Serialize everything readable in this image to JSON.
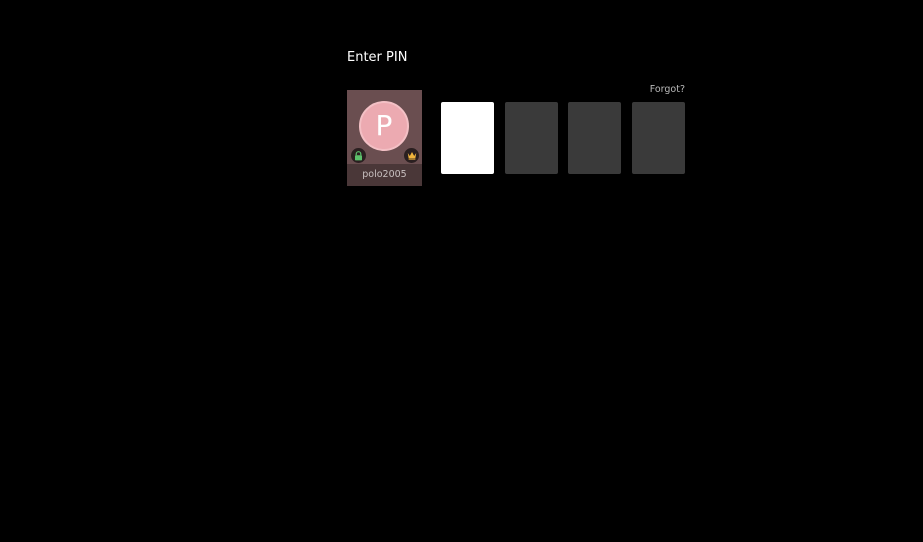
{
  "header": {
    "title": "Enter PIN"
  },
  "forgot_label": "Forgot?",
  "profile": {
    "initial": "P",
    "username": "polo2005",
    "avatar_color": "#ecaab1",
    "badges": [
      "lock-icon",
      "crown-icon"
    ]
  },
  "pin": {
    "digits": 4,
    "active_index": 0
  },
  "colors": {
    "background": "#000000",
    "pin_active": "#ffffff",
    "pin_inactive": "#3a3a3a",
    "lock_badge": "#5cc06b",
    "crown_badge": "#f0b43c"
  }
}
